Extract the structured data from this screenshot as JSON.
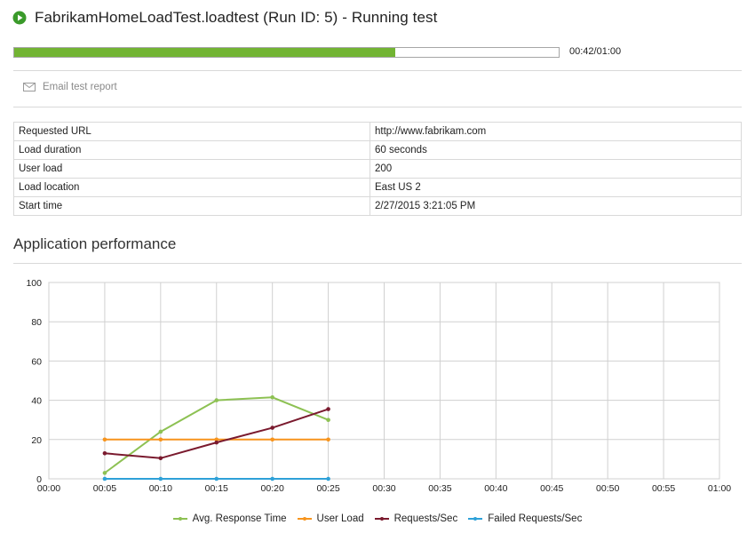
{
  "header": {
    "title": "FabrikamHomeLoadTest.loadtest (Run ID: 5) - Running test",
    "status_icon": "play-circle-icon",
    "status_color": "#3a9a2a"
  },
  "progress": {
    "fraction": 0.7,
    "time_text": "00:42/01:00",
    "color": "#72b433"
  },
  "actions": {
    "email_label": "Email test report",
    "email_icon": "mail-icon"
  },
  "info_table": [
    {
      "key": "Requested URL",
      "value": "http://www.fabrikam.com"
    },
    {
      "key": "Load duration",
      "value": "60 seconds"
    },
    {
      "key": "User load",
      "value": "200"
    },
    {
      "key": "Load location",
      "value": "East US 2"
    },
    {
      "key": "Start time",
      "value": "2/27/2015 3:21:05 PM"
    }
  ],
  "section": {
    "title": "Application performance"
  },
  "chart_data": {
    "type": "line",
    "x_ticks": [
      "00:00",
      "00:05",
      "00:10",
      "00:15",
      "00:20",
      "00:25",
      "00:30",
      "00:35",
      "00:40",
      "00:45",
      "00:50",
      "00:55",
      "01:00"
    ],
    "y_ticks": [
      "0",
      "20",
      "40",
      "60",
      "80",
      "100"
    ],
    "ylim": [
      0,
      100
    ],
    "xlim_seconds": [
      0,
      60
    ],
    "grid": true,
    "legend_position": "bottom",
    "series": [
      {
        "name": "Avg. Response Time",
        "color": "#8dc153",
        "x": [
          "00:05",
          "00:10",
          "00:15",
          "00:20",
          "00:25"
        ],
        "values": [
          3,
          24,
          40,
          41.5,
          30
        ]
      },
      {
        "name": "User Load",
        "color": "#f7941d",
        "x": [
          "00:05",
          "00:10",
          "00:15",
          "00:20",
          "00:25"
        ],
        "values": [
          20,
          20,
          20,
          20,
          20
        ]
      },
      {
        "name": "Requests/Sec",
        "color": "#7a1a2e",
        "x": [
          "00:05",
          "00:10",
          "00:15",
          "00:20",
          "00:25"
        ],
        "values": [
          13,
          10.5,
          18.5,
          26,
          35.5
        ]
      },
      {
        "name": "Failed Requests/Sec",
        "color": "#2ea1d8",
        "x": [
          "00:05",
          "00:10",
          "00:15",
          "00:20",
          "00:25"
        ],
        "values": [
          0,
          0,
          0,
          0,
          0
        ]
      }
    ]
  }
}
